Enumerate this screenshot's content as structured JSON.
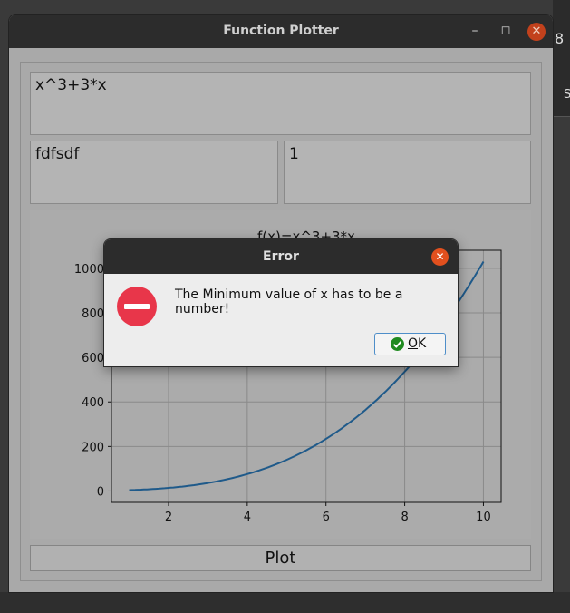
{
  "window": {
    "title": "Function Plotter",
    "minimize_icon": "minimize-icon",
    "maximize_icon": "maximize-icon",
    "close_icon": "close-icon"
  },
  "inputs": {
    "function_value": "x^3+3*x",
    "min_value": "fdfsdf",
    "max_value": "1"
  },
  "plot_button": {
    "label": "Plot"
  },
  "chart_data": {
    "type": "line",
    "title": "f(x)=x^3+3*x",
    "xlabel": "",
    "ylabel": "",
    "xlim": [
      0.55,
      10.45
    ],
    "ylim": [
      -51,
      1081
    ],
    "xticks": [
      2,
      4,
      6,
      8,
      10
    ],
    "yticks": [
      0,
      200,
      400,
      600,
      800,
      1000
    ],
    "grid": true,
    "series": [
      {
        "color": "#1f5a8a",
        "function": "x^3+3*x",
        "x_range": [
          1,
          10
        ]
      }
    ]
  },
  "dialog": {
    "title": "Error",
    "message": "The Minimum value of x has to be a number!",
    "ok_label_rest": "K",
    "ok_label_underlined": "O",
    "icon": "error-icon"
  },
  "colors": {
    "accent_close": "#e2501e",
    "error_red": "#e8364a",
    "ok_green": "#1f8a1f",
    "line": "#1f5a8a"
  }
}
